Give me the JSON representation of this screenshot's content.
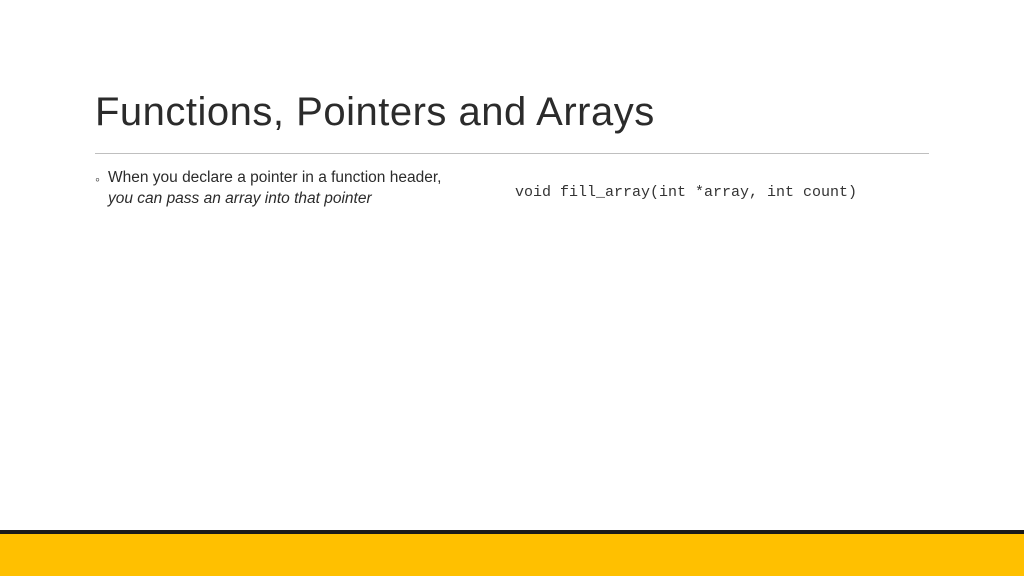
{
  "slide": {
    "title": "Functions, Pointers and Arrays",
    "bullet": {
      "line1": "When you declare a pointer in a function header,",
      "line2": "you can pass an array into that pointer"
    },
    "code": "void fill_array(int *array, int count)"
  },
  "colors": {
    "accent": "#ffc000",
    "accent_dark": "#1a1a1a"
  }
}
